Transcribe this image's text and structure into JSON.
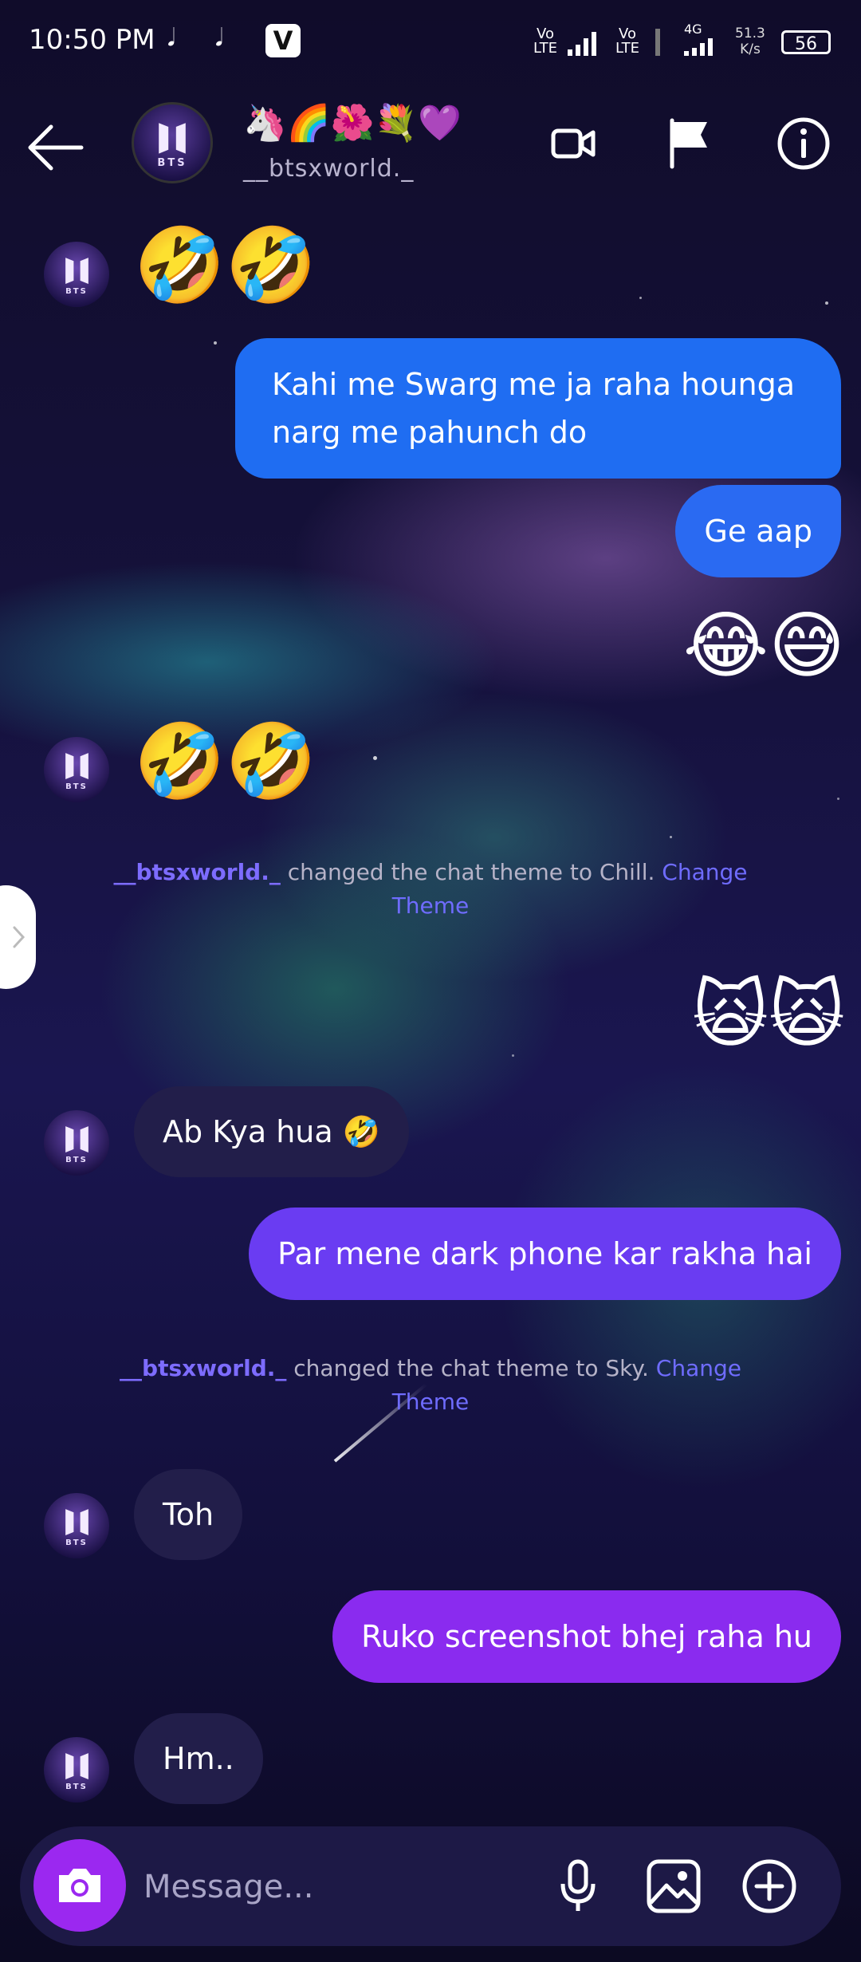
{
  "status_bar": {
    "time": "10:50 PM",
    "notif_icons": [
      "notification-icon",
      "notification-icon"
    ],
    "app_badge": "V",
    "sim1": "Vo LTE",
    "sim2": "Vo LTE",
    "network": "4G",
    "speed_value": "51.3",
    "speed_unit": "K/s",
    "battery": "56"
  },
  "header": {
    "title_emojis": "🦄🌈🌺💐💜",
    "username": "__btsxworld._",
    "avatar_text": "BTS"
  },
  "messages": [
    {
      "type": "in_emoji",
      "text": "🤣🤣"
    },
    {
      "type": "out",
      "text": "Kahi me Swarg me ja raha hounga narg me pahunch do",
      "color": "#1f6df2"
    },
    {
      "type": "out",
      "text": "Ge aap",
      "color": "#2a6af2"
    },
    {
      "type": "out_emoji",
      "text": "😂😅"
    },
    {
      "type": "in_emoji",
      "text": "🤣🤣"
    },
    {
      "type": "system",
      "user": "__btsxworld._",
      "text": " changed the chat theme to Chill. ",
      "link": "Change Theme"
    },
    {
      "type": "out_emoji",
      "text": "🙀🙀"
    },
    {
      "type": "in",
      "text": "Ab Kya hua 🤣"
    },
    {
      "type": "out",
      "text": "Par mene dark phone kar rakha hai",
      "color": "#6a3cf2"
    },
    {
      "type": "system",
      "user": "__btsxworld._",
      "text": " changed the chat theme to Sky. ",
      "link": "Change Theme"
    },
    {
      "type": "in",
      "text": "Toh"
    },
    {
      "type": "out",
      "text": "Ruko screenshot bhej raha hu",
      "color": "#8a2bef"
    },
    {
      "type": "in",
      "text": "Hm.."
    }
  ],
  "composer": {
    "placeholder": "Message..."
  },
  "colors": {
    "accent_purple": "#9b28f0",
    "link_blue": "#6f6cff"
  }
}
